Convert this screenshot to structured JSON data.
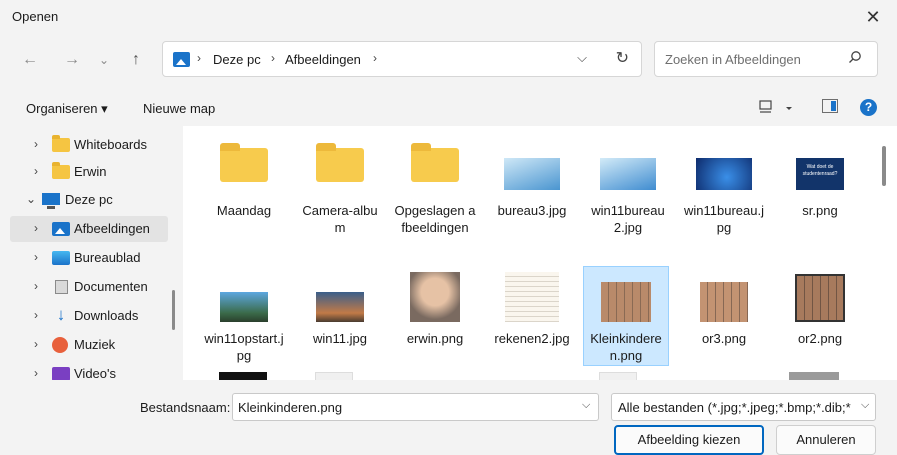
{
  "window": {
    "title": "Openen",
    "close_icon": "close-icon"
  },
  "nav_buttons": {
    "back": "←",
    "forward": "→",
    "recent": "⌄",
    "up": "↑"
  },
  "address": {
    "crumbs": [
      "Deze pc",
      "Afbeeldingen"
    ],
    "separator": "›"
  },
  "search": {
    "placeholder": "Zoeken in Afbeeldingen"
  },
  "toolbar": {
    "organize": "Organiseren ▾",
    "new_folder": "Nieuwe map",
    "help": "?"
  },
  "sidebar": {
    "items": [
      {
        "label": "Whiteboards",
        "icon": "folder-icon"
      },
      {
        "label": "Erwin",
        "icon": "folder-icon"
      },
      {
        "label": "Deze pc",
        "icon": "pc-icon"
      },
      {
        "label": "Afbeeldingen",
        "icon": "pictures-icon"
      },
      {
        "label": "Bureaublad",
        "icon": "desktop-icon"
      },
      {
        "label": "Documenten",
        "icon": "document-icon"
      },
      {
        "label": "Downloads",
        "icon": "download-icon"
      },
      {
        "label": "Muziek",
        "icon": "music-icon"
      },
      {
        "label": "Video's",
        "icon": "video-icon"
      }
    ]
  },
  "files": [
    {
      "name": "Maandag",
      "kind": "folder"
    },
    {
      "name": "Camera-album",
      "kind": "folder"
    },
    {
      "name": "Opgeslagen afbeeldingen",
      "kind": "folder"
    },
    {
      "name": "bureau3.jpg",
      "kind": "image"
    },
    {
      "name": "win11bureau2.jpg",
      "kind": "image"
    },
    {
      "name": "win11bureau.jpg",
      "kind": "image"
    },
    {
      "name": "sr.png",
      "kind": "image",
      "thumb_text": "Wat doet de studentenraad?"
    },
    {
      "name": "win11opstart.jpg",
      "kind": "image"
    },
    {
      "name": "win11.jpg",
      "kind": "image"
    },
    {
      "name": "erwin.png",
      "kind": "image"
    },
    {
      "name": "rekenen2.jpg",
      "kind": "image"
    },
    {
      "name": "Kleinkinderen.png",
      "kind": "image",
      "selected": true
    },
    {
      "name": "or3.png",
      "kind": "image"
    },
    {
      "name": "or2.png",
      "kind": "image"
    }
  ],
  "footer": {
    "filename_label": "Bestandsnaam:",
    "filename_value": "Kleinkinderen.png",
    "filter": "Alle bestanden (*.jpg;*.jpeg;*.bmp;*.dib;*",
    "ok": "Afbeelding kiezen",
    "cancel": "Annuleren"
  }
}
